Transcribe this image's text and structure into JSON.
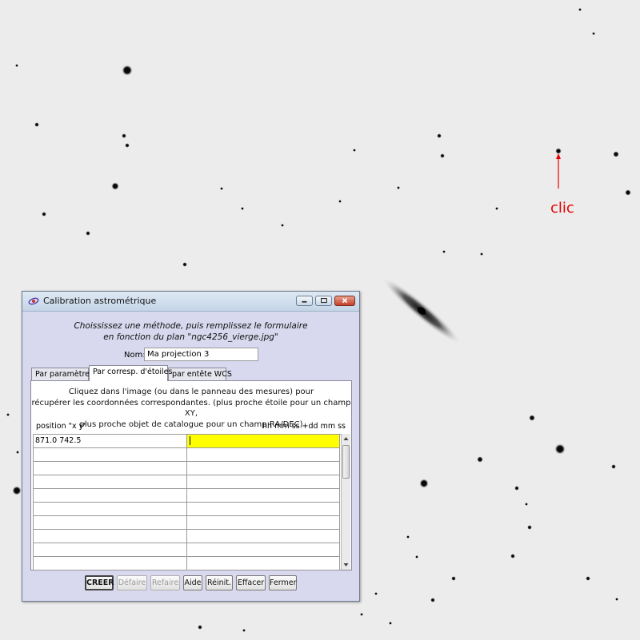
{
  "annotation": {
    "text": "clic",
    "color": "#e80000"
  },
  "dialog": {
    "title": "Calibration astrométrique",
    "instructions": [
      "Choississez une méthode, puis remplissez le formulaire",
      "en fonction du plan \"ngc4256_vierge.jpg\""
    ],
    "name_label": "Nom:",
    "name_value": "Ma projection 3",
    "tabs": [
      {
        "label": "Par paramètres",
        "active": false
      },
      {
        "label": "Par corresp. d'étoiles",
        "active": true
      },
      {
        "label": "par entête WCS",
        "active": false
      }
    ],
    "panel_text": [
      "Cliquez dans l'image (ou dans le panneau des mesures) pour",
      "récupérer les coordonnées correspondantes. (plus proche étoile pour un champ XY,",
      "plus proche objet de catalogue pour un champ RA/DEC)"
    ],
    "col_header_xy": "position \"x y\"",
    "col_header_radec": "hh mm ss +dd mm ss",
    "rows": [
      {
        "xy": "871.0  742.5",
        "radec": ""
      },
      {
        "xy": "",
        "radec": ""
      },
      {
        "xy": "",
        "radec": ""
      },
      {
        "xy": "",
        "radec": ""
      },
      {
        "xy": "",
        "radec": ""
      },
      {
        "xy": "",
        "radec": ""
      },
      {
        "xy": "",
        "radec": ""
      },
      {
        "xy": "",
        "radec": ""
      },
      {
        "xy": "",
        "radec": ""
      },
      {
        "xy": "",
        "radec": ""
      }
    ],
    "buttons": {
      "create": "CREER",
      "undo": "Défaire",
      "redo": "Refaire",
      "help": "Aide",
      "reset": "Réinit.",
      "clear": "Effacer",
      "close": "Fermer"
    },
    "active_cell_color": "#ffff00"
  }
}
